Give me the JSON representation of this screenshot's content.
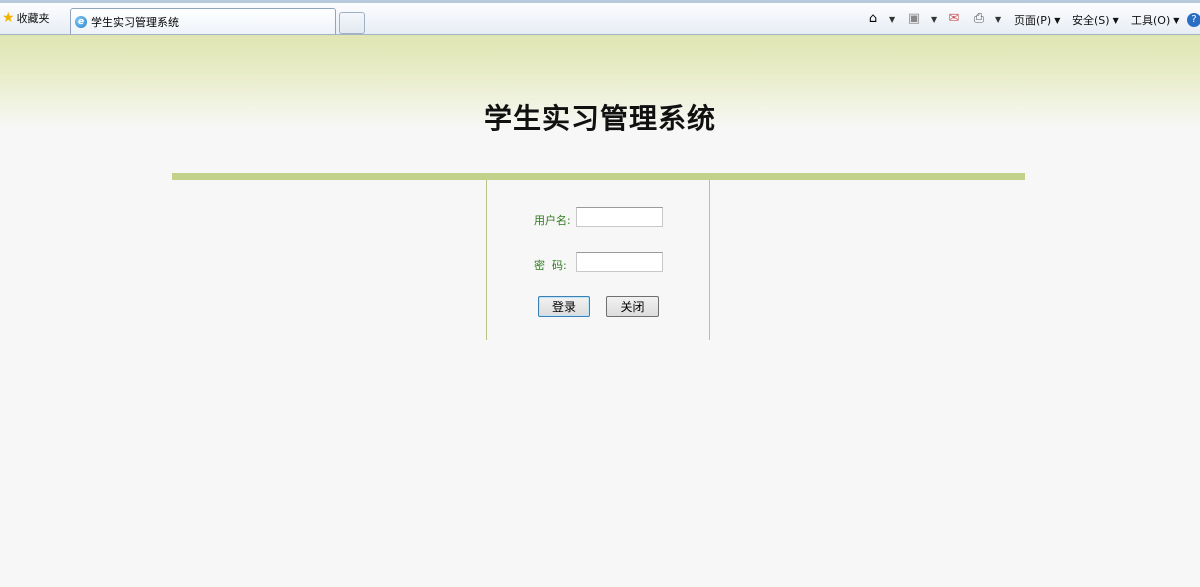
{
  "browser": {
    "favorites_label": "收藏夹",
    "tab_title": "学生实习管理系统",
    "menu": {
      "page": "页面(P)",
      "safety": "安全(S)",
      "tools": "工具(O)"
    },
    "icons": [
      "home-icon",
      "feeds-icon",
      "mail-icon",
      "print-icon",
      "help-icon"
    ]
  },
  "page": {
    "title": "学生实习管理系统",
    "colors": {
      "header_band": "#dfe5b2",
      "divider_bar": "#c3d28a",
      "label_text": "#2d7a1e"
    }
  },
  "login": {
    "username_label": "用户名:",
    "username_value": "",
    "password_label": "密  码:",
    "password_value": "",
    "login_button": "登录",
    "close_button": "关闭"
  }
}
